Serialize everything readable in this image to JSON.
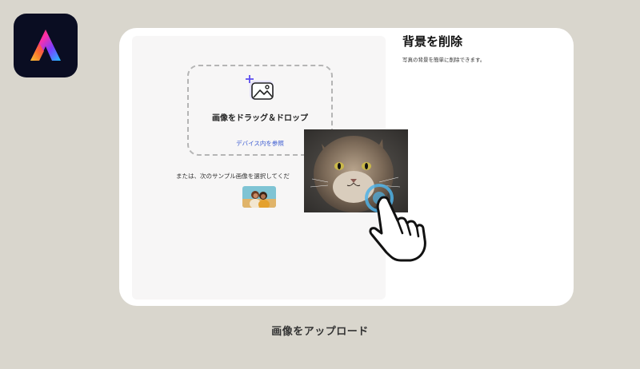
{
  "app": {
    "logo_icon": "adobe-express-logo"
  },
  "upload_panel": {
    "dropzone_title": "画像をドラッグ＆ドロップ",
    "browse_link": "デバイス内を参照",
    "sample_prompt": "または、次のサンプル画像を選択してくだ",
    "upload_icon": "image-plus-icon"
  },
  "info_panel": {
    "title": "背景を削除",
    "description": "写真の背景を簡単に削除できます。"
  },
  "dragged_image": {
    "subject": "cat-photo"
  },
  "cursor": {
    "icon": "hand-pointer-icon"
  },
  "caption": "画像をアップロード",
  "colors": {
    "background": "#d9d6cd",
    "card": "#ffffff",
    "panel": "#f7f6f6",
    "link": "#3b5bd1",
    "click_ring": "#4fb2e6",
    "logo_bg": "#0a0d22"
  }
}
